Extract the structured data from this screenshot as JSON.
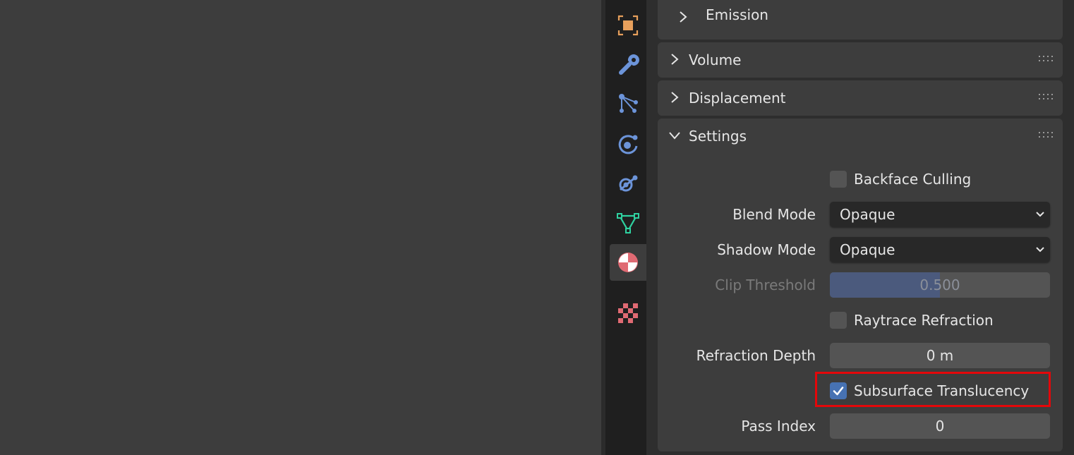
{
  "tabs": [
    {
      "name": "object",
      "icon": "object-icon",
      "active": false
    },
    {
      "name": "modifiers",
      "icon": "wrench-icon",
      "active": false
    },
    {
      "name": "particles",
      "icon": "particles-icon",
      "active": false
    },
    {
      "name": "physics",
      "icon": "physics-icon",
      "active": false
    },
    {
      "name": "constraints",
      "icon": "constraints-icon",
      "active": false
    },
    {
      "name": "data",
      "icon": "mesh-data-icon",
      "active": false
    },
    {
      "name": "material",
      "icon": "material-icon",
      "active": true
    },
    {
      "name": "texture",
      "icon": "texture-icon",
      "active": false
    }
  ],
  "panels": {
    "emission": {
      "title": "Emission",
      "expanded": false
    },
    "volume": {
      "title": "Volume",
      "expanded": false
    },
    "displacement": {
      "title": "Displacement",
      "expanded": false
    },
    "settings": {
      "title": "Settings",
      "expanded": true
    }
  },
  "settings": {
    "backface_culling": {
      "label": "Backface Culling",
      "checked": false
    },
    "blend_mode": {
      "label": "Blend Mode",
      "value": "Opaque"
    },
    "shadow_mode": {
      "label": "Shadow Mode",
      "value": "Opaque"
    },
    "clip_threshold": {
      "label": "Clip Threshold",
      "value": "0.500",
      "fraction": 0.5,
      "enabled": false
    },
    "raytrace_refraction": {
      "label": "Raytrace Refraction",
      "checked": false
    },
    "refraction_depth": {
      "label": "Refraction Depth",
      "value": "0 m"
    },
    "subsurface_translucency": {
      "label": "Subsurface Translucency",
      "checked": true,
      "highlighted": true
    },
    "pass_index": {
      "label": "Pass Index",
      "value": "0"
    }
  },
  "colors": {
    "checkbox_checked": "#4772b3",
    "slider_fill": "#4b5a7d",
    "highlight": "#e4070a",
    "material_icon": "#e06a73",
    "object_icon": "#e8a05c",
    "tool_icon": "#6c94d9",
    "data_icon": "#2fd1a0"
  }
}
